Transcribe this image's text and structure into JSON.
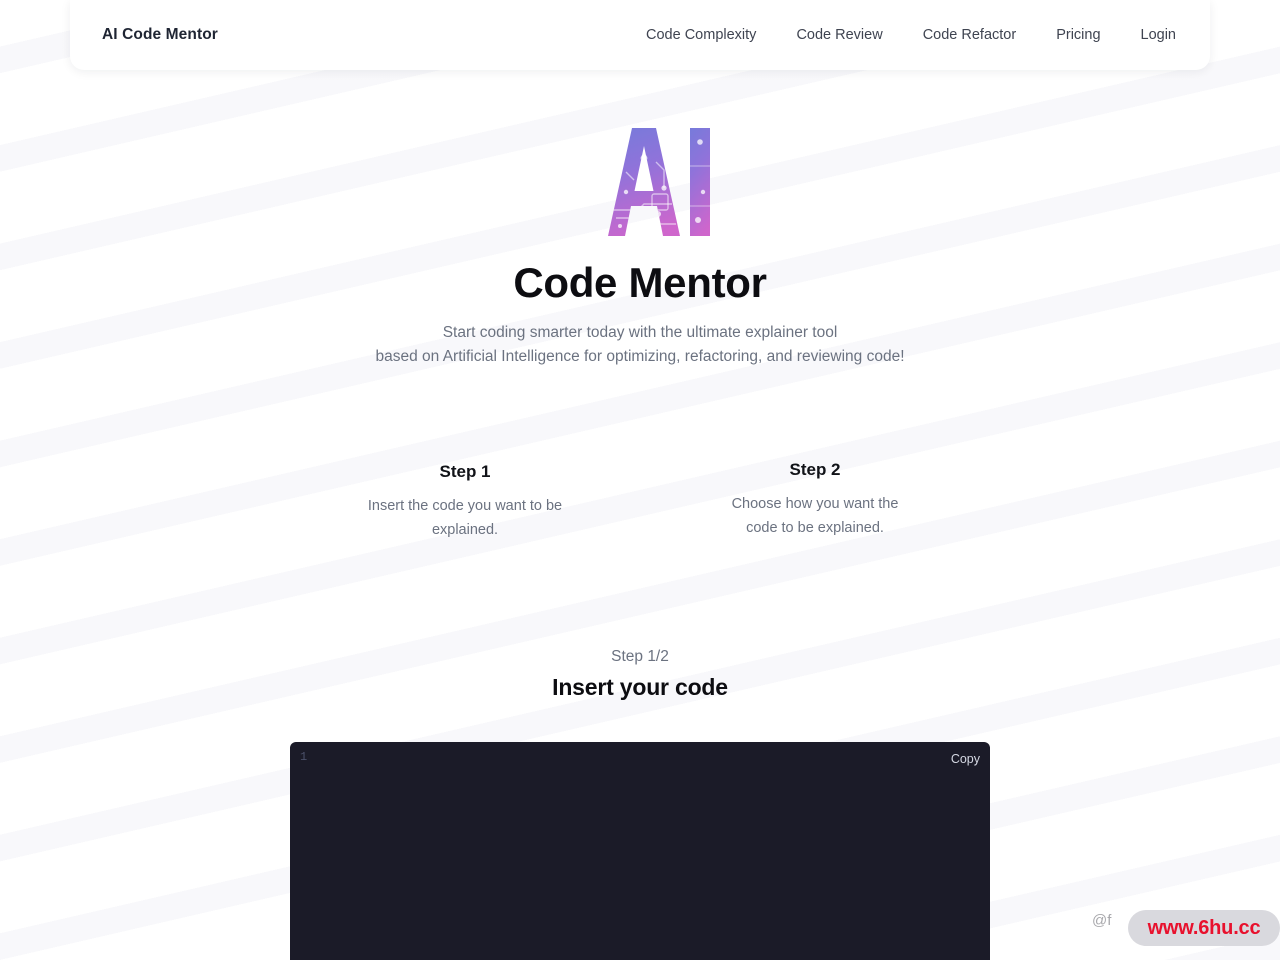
{
  "header": {
    "brand": "AI Code Mentor",
    "nav": [
      {
        "label": "Code Complexity",
        "name": "nav-link-code-complexity"
      },
      {
        "label": "Code Review",
        "name": "nav-link-code-review"
      },
      {
        "label": "Code Refactor",
        "name": "nav-link-code-refactor"
      },
      {
        "label": "Pricing",
        "name": "nav-link-pricing"
      },
      {
        "label": "Login",
        "name": "nav-link-login"
      }
    ]
  },
  "hero": {
    "logo_text": "AI",
    "logo_icon": "ai-circuit-logo",
    "title": "Code Mentor",
    "subtitle_line1": "Start coding smarter today with the ultimate explainer tool",
    "subtitle_line2": "based on Artificial Intelligence for optimizing, refactoring, and reviewing code!"
  },
  "steps": [
    {
      "title": "Step 1",
      "desc_line1": "Insert the code you want to be",
      "desc_line2": "explained."
    },
    {
      "title": "Step 2",
      "desc_line1": "Choose how you want the",
      "desc_line2": "code to be explained."
    }
  ],
  "editor": {
    "step_counter": "Step 1/2",
    "heading": "Insert your code",
    "line_number": "1",
    "copy_label": "Copy",
    "code_value": "",
    "code_placeholder": ""
  },
  "watermark": {
    "handle": "@f",
    "badge_text": "www.6hu.cc"
  },
  "colors": {
    "page_background": "#ffffff",
    "header_background": "#ffffff",
    "text_primary": "#0d0d11",
    "text_muted": "#6b7280",
    "editor_background": "#1b1b28",
    "logo_gradient_start": "#6f7ddb",
    "logo_gradient_end": "#c767cf",
    "watermark_red": "#e8112d"
  }
}
